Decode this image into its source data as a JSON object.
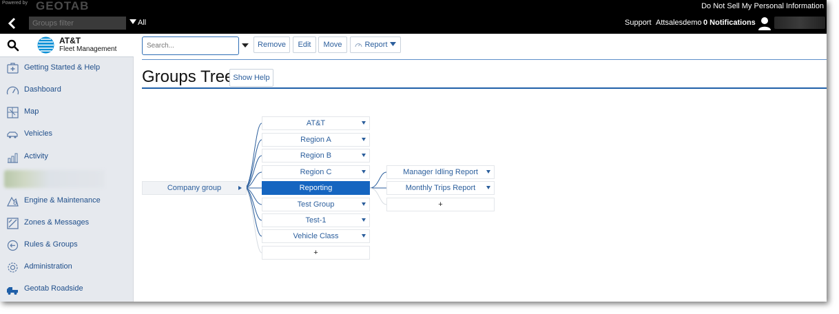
{
  "topbar": {
    "powered_by": "Powered by",
    "brand": "GEOTAB",
    "privacy_link": "Do Not Sell My Personal Information",
    "groups_filter_placeholder": "Groups filter",
    "all_label": "All",
    "support": "Support",
    "user": "Attsalesdemo",
    "notifications": "0 Notifications"
  },
  "sidebar": {
    "brand_title": "AT&T",
    "brand_subtitle": "Fleet Management",
    "items": [
      {
        "label": "Getting Started & Help",
        "icon": "help-kit-icon"
      },
      {
        "label": "Dashboard",
        "icon": "gauge-icon"
      },
      {
        "label": "Map",
        "icon": "map-icon"
      },
      {
        "label": "Vehicles",
        "icon": "vehicle-icon"
      },
      {
        "label": "Activity",
        "icon": "activity-chart-icon"
      },
      {
        "label": "Engine & Maintenance",
        "icon": "engine-icon"
      },
      {
        "label": "Zones & Messages",
        "icon": "zones-icon"
      },
      {
        "label": "Rules & Groups",
        "icon": "rules-icon"
      },
      {
        "label": "Administration",
        "icon": "gear-icon"
      },
      {
        "label": "Geotab Roadside",
        "icon": "tow-truck-icon"
      }
    ]
  },
  "toolbar": {
    "search_placeholder": "Search...",
    "remove": "Remove",
    "edit": "Edit",
    "move": "Move",
    "report": "Report"
  },
  "page": {
    "title": "Groups Tree",
    "help_button": "Show Help"
  },
  "tree": {
    "root": "Company group",
    "children": [
      "AT&T",
      "Region A",
      "Region B",
      "Region C",
      "Reporting",
      "Test Group",
      "Test-1",
      "Vehicle Class",
      "+"
    ],
    "selected": "Reporting",
    "sub_children": [
      "Manager Idling Report",
      "Monthly Trips Report",
      "+"
    ]
  },
  "colors": {
    "accent": "#1565c0",
    "link": "#2b5e9c",
    "topbar": "#000000",
    "sidebar_bg": "#e6e9ee"
  }
}
